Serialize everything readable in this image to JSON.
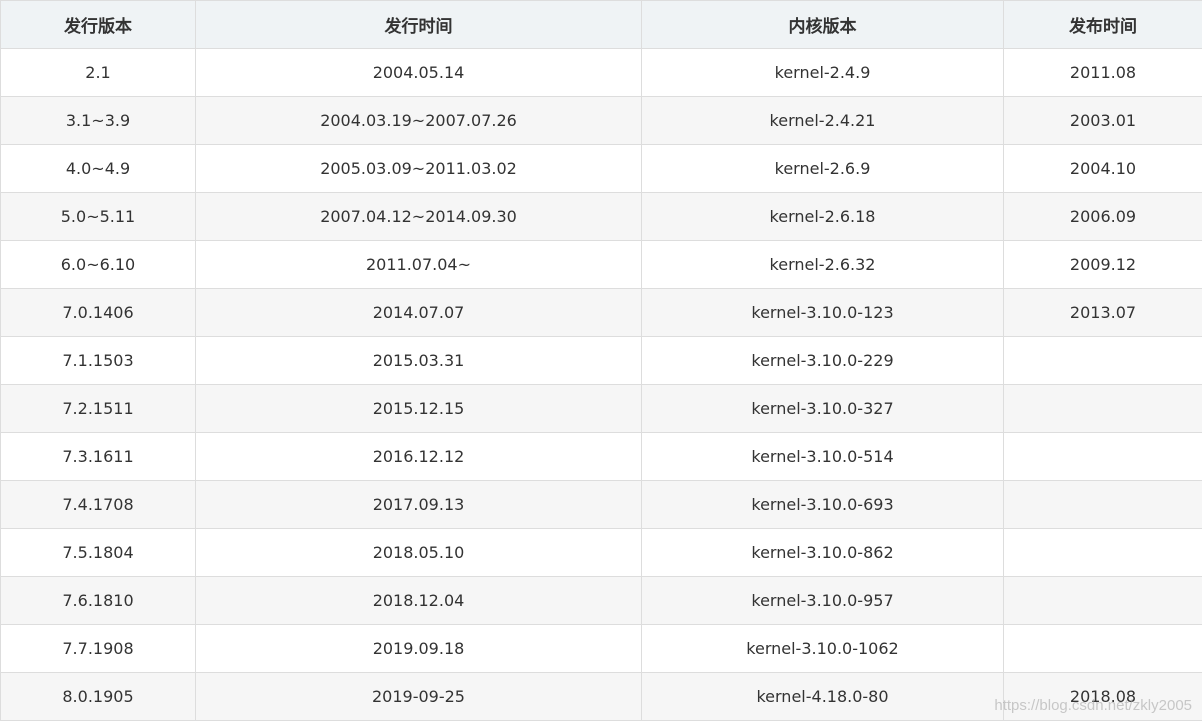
{
  "headers": [
    "发行版本",
    "发行时间",
    "内核版本",
    "发布时间"
  ],
  "rows": [
    [
      "2.1",
      "2004.05.14",
      "kernel-2.4.9",
      "2011.08"
    ],
    [
      "3.1~3.9",
      "2004.03.19~2007.07.26",
      "kernel-2.4.21",
      "2003.01"
    ],
    [
      "4.0~4.9",
      "2005.03.09~2011.03.02",
      "kernel-2.6.9",
      "2004.10"
    ],
    [
      "5.0~5.11",
      "2007.04.12~2014.09.30",
      "kernel-2.6.18",
      "2006.09"
    ],
    [
      "6.0~6.10",
      "2011.07.04~",
      "kernel-2.6.32",
      "2009.12"
    ],
    [
      "7.0.1406",
      "2014.07.07",
      "kernel-3.10.0-123",
      "2013.07"
    ],
    [
      "7.1.1503",
      "2015.03.31",
      "kernel-3.10.0-229",
      ""
    ],
    [
      "7.2.1511",
      "2015.12.15",
      "kernel-3.10.0-327",
      ""
    ],
    [
      "7.3.1611",
      "2016.12.12",
      "kernel-3.10.0-514",
      ""
    ],
    [
      "7.4.1708",
      "2017.09.13",
      "kernel-3.10.0-693",
      ""
    ],
    [
      "7.5.1804",
      "2018.05.10",
      "kernel-3.10.0-862",
      ""
    ],
    [
      "7.6.1810",
      "2018.12.04",
      "kernel-3.10.0-957",
      ""
    ],
    [
      "7.7.1908",
      "2019.09.18",
      "kernel-3.10.0-1062",
      ""
    ],
    [
      "8.0.1905",
      "2019-09-25",
      "kernel-4.18.0-80",
      "2018.08"
    ]
  ],
  "watermark": "https://blog.csdn.net/zkly2005"
}
